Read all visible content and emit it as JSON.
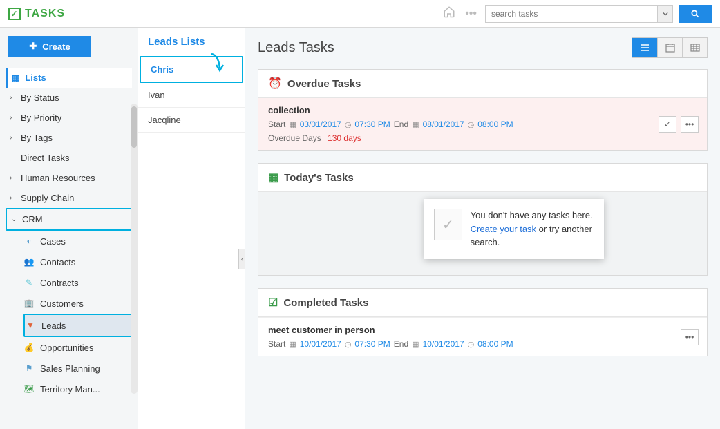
{
  "header": {
    "app_name": "TASKS",
    "search_placeholder": "search tasks"
  },
  "sidebar": {
    "create_label": "Create",
    "lists_label": "Lists",
    "items": [
      {
        "label": "By Status"
      },
      {
        "label": "By Priority"
      },
      {
        "label": "By Tags"
      },
      {
        "label": "Direct Tasks"
      },
      {
        "label": "Human Resources"
      },
      {
        "label": "Supply Chain"
      },
      {
        "label": "CRM"
      }
    ],
    "crm_items": [
      {
        "label": "Cases"
      },
      {
        "label": "Contacts"
      },
      {
        "label": "Contracts"
      },
      {
        "label": "Customers"
      },
      {
        "label": "Leads"
      },
      {
        "label": "Opportunities"
      },
      {
        "label": "Sales Planning"
      },
      {
        "label": "Territory Man..."
      }
    ]
  },
  "leads_panel": {
    "title": "Leads Lists",
    "items": [
      {
        "label": "Chris",
        "selected": true
      },
      {
        "label": "Ivan"
      },
      {
        "label": "Jacqline"
      }
    ]
  },
  "main": {
    "title": "Leads Tasks",
    "sections": {
      "overdue": {
        "title": "Overdue Tasks",
        "tasks": [
          {
            "title": "collection",
            "start_label": "Start",
            "start_date": "03/01/2017",
            "start_time": "07:30 PM",
            "end_label": "End",
            "end_date": "08/01/2017",
            "end_time": "08:00 PM",
            "overdue_label": "Overdue Days",
            "overdue_value": "130 days"
          }
        ]
      },
      "today": {
        "title": "Today's Tasks",
        "empty_msg1": "You don't have any tasks here.",
        "empty_link": "Create your task",
        "empty_msg2": " or try another search."
      },
      "completed": {
        "title": "Completed Tasks",
        "tasks": [
          {
            "title": "meet customer in person",
            "start_label": "Start",
            "start_date": "10/01/2017",
            "start_time": "07:30 PM",
            "end_label": "End",
            "end_date": "10/01/2017",
            "end_time": "08:00 PM"
          }
        ]
      }
    }
  }
}
